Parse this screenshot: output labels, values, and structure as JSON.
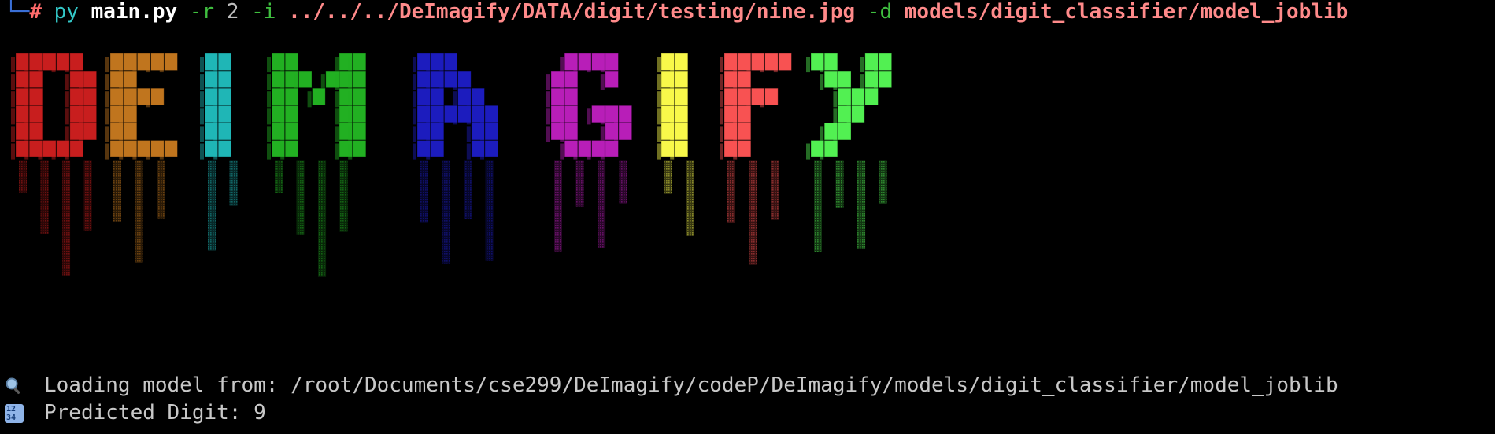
{
  "terminal": {
    "prompt": {
      "tree_glyph": "└─",
      "hash": "#",
      "command": "py",
      "script": "main.py",
      "flag_r": "-r",
      "r_value": "2",
      "flag_i": "-i",
      "image_path": "../../../DeImagify/DATA/digit/testing/nine.jpg",
      "flag_d": "-d",
      "model_dir": "models/digit_classifier/model_joblib"
    },
    "banner": {
      "letters": [
        {
          "char": "D",
          "color": "#c81e1e"
        },
        {
          "char": "E",
          "color": "#c0751e"
        },
        {
          "char": "I",
          "color": "#1fb6b6"
        },
        {
          "char": "M",
          "color": "#22b022"
        },
        {
          "char": "A",
          "color": "#1c1cbe"
        },
        {
          "char": "G",
          "color": "#b81eb8"
        },
        {
          "char": "I",
          "color": "#f8f84a"
        },
        {
          "char": "F",
          "color": "#f85252"
        },
        {
          "char": "Y",
          "color": "#52f052"
        }
      ]
    },
    "output": {
      "loading_icon": "magnifier-icon",
      "loading_text": "Loading model from: /root/Documents/cse299/DeImagify/codeP/DeImagify/models/digit_classifier/model_joblib",
      "predict_icon": "input-numbers-icon",
      "predict_label": "Predicted Digit:",
      "predict_value": "9"
    }
  }
}
